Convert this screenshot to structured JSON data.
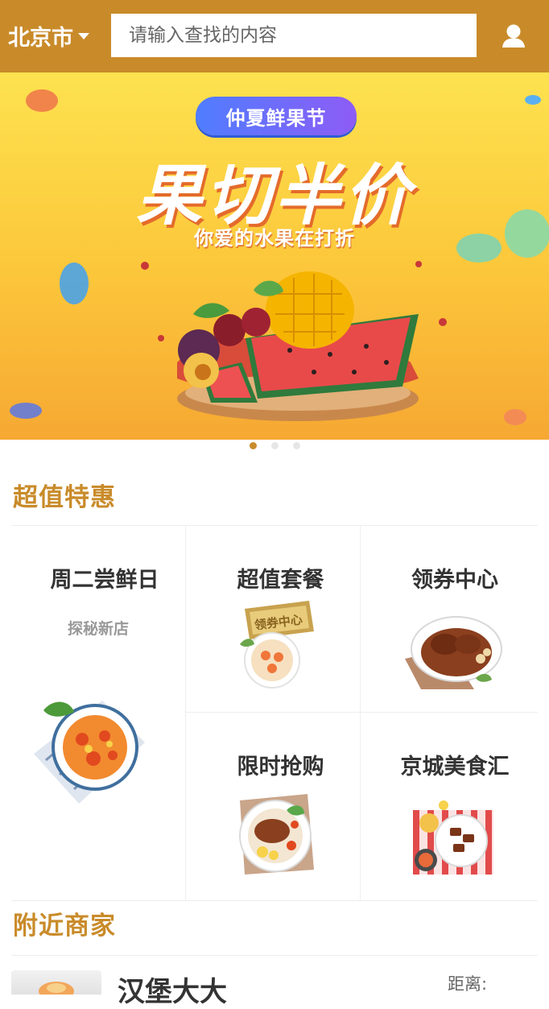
{
  "header": {
    "city": "北京市",
    "search_placeholder": "请输入查找的内容"
  },
  "banner": {
    "badge": "仲夏鲜果节",
    "headline": "果切半价",
    "subline": "你爱的水果在打折",
    "slide_count": 3,
    "active_slide": 1
  },
  "deals": {
    "title": "超值特惠",
    "items": [
      {
        "title": "周二尝鲜日",
        "subtitle": "探秘新店",
        "icon": "pasta-plate-icon"
      },
      {
        "title": "超值套餐",
        "stamp": "领券中心",
        "icon": "shrimp-plate-icon"
      },
      {
        "title": "领券中心",
        "icon": "steak-plate-icon"
      },
      {
        "title": "限时抢购",
        "icon": "grilled-meat-plate-icon"
      },
      {
        "title": "京城美食汇",
        "icon": "food-spread-icon"
      }
    ]
  },
  "nearby": {
    "title": "附近商家",
    "items": [
      {
        "name": "汉堡大大",
        "distance_label": "距离:"
      }
    ]
  },
  "colors": {
    "brand": "#c98b2a",
    "text_primary": "#333333",
    "text_secondary": "#999999"
  }
}
